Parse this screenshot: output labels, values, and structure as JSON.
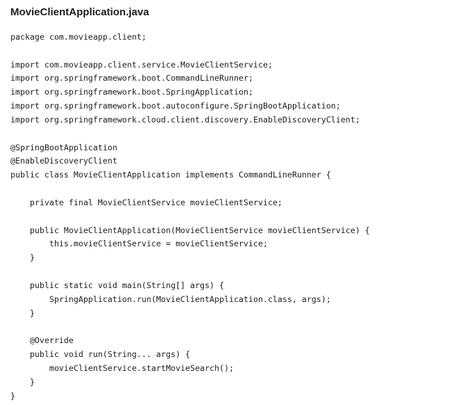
{
  "file": {
    "name": "MovieClientApplication.java"
  },
  "code": {
    "lines": [
      "package com.movieapp.client;",
      "",
      "import com.movieapp.client.service.MovieClientService;",
      "import org.springframework.boot.CommandLineRunner;",
      "import org.springframework.boot.SpringApplication;",
      "import org.springframework.boot.autoconfigure.SpringBootApplication;",
      "import org.springframework.cloud.client.discovery.EnableDiscoveryClient;",
      "",
      "@SpringBootApplication",
      "@EnableDiscoveryClient",
      "public class MovieClientApplication implements CommandLineRunner {",
      "",
      "    private final MovieClientService movieClientService;",
      "",
      "    public MovieClientApplication(MovieClientService movieClientService) {",
      "        this.movieClientService = movieClientService;",
      "    }",
      "",
      "    public static void main(String[] args) {",
      "        SpringApplication.run(MovieClientApplication.class, args);",
      "    }",
      "",
      "    @Override",
      "    public void run(String... args) {",
      "        movieClientService.startMovieSearch();",
      "    }",
      "}"
    ]
  }
}
